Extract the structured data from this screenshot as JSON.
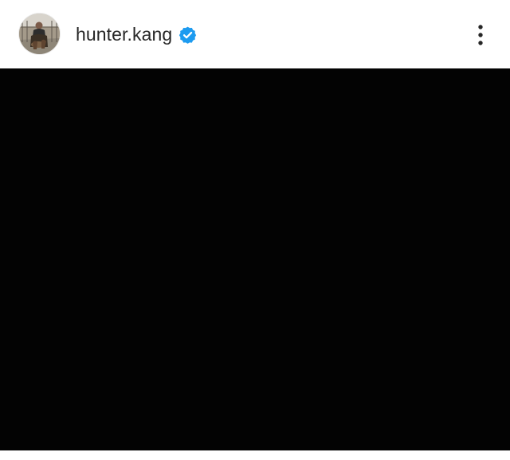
{
  "post": {
    "author": {
      "username": "hunter.kang",
      "verified": true
    },
    "media": {
      "background": "#030303"
    }
  },
  "icons": {
    "verified": "verified-badge-icon",
    "more": "more-options-icon"
  },
  "colors": {
    "verified_blue": "#1d9bf0",
    "text_primary": "#262626"
  }
}
